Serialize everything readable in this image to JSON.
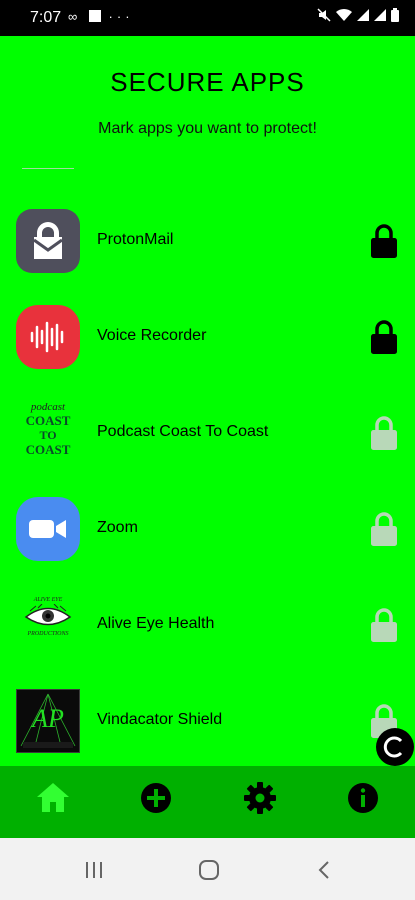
{
  "status_bar": {
    "time": "7:07",
    "left_icons": "∞ ··· "
  },
  "header": {
    "title": "SECURE APPS",
    "subtitle": "Mark apps you want to protect!"
  },
  "apps": [
    {
      "name": "ProtonMail",
      "icon": "protonmail-icon",
      "locked": true
    },
    {
      "name": "Voice Recorder",
      "icon": "voice-recorder-icon",
      "locked": true
    },
    {
      "name": "Podcast Coast To Coast",
      "icon": "podcast-coast-to-coast-icon",
      "locked": false,
      "icon_text": [
        "podcast",
        "COAST",
        "TO",
        "COAST"
      ]
    },
    {
      "name": "Zoom",
      "icon": "zoom-icon",
      "locked": false
    },
    {
      "name": "Alive Eye Health",
      "icon": "alive-eye-icon",
      "locked": false,
      "icon_text": [
        "ALIVE EYE",
        "PRODUCTIONS"
      ]
    },
    {
      "name": "Vindacator Shield",
      "icon": "vindacator-shield-icon",
      "locked": false,
      "icon_text": [
        "AP"
      ]
    }
  ],
  "bottom_nav": [
    {
      "name": "home",
      "icon": "home-icon",
      "active": true
    },
    {
      "name": "add",
      "icon": "add-circle-icon",
      "active": false
    },
    {
      "name": "settings",
      "icon": "gear-icon",
      "active": false
    },
    {
      "name": "info",
      "icon": "info-icon",
      "active": false
    }
  ],
  "colors": {
    "background": "#00ff00",
    "bottom_nav": "#00b000",
    "locked": "#000000",
    "unlocked": "#b8d8b8"
  }
}
